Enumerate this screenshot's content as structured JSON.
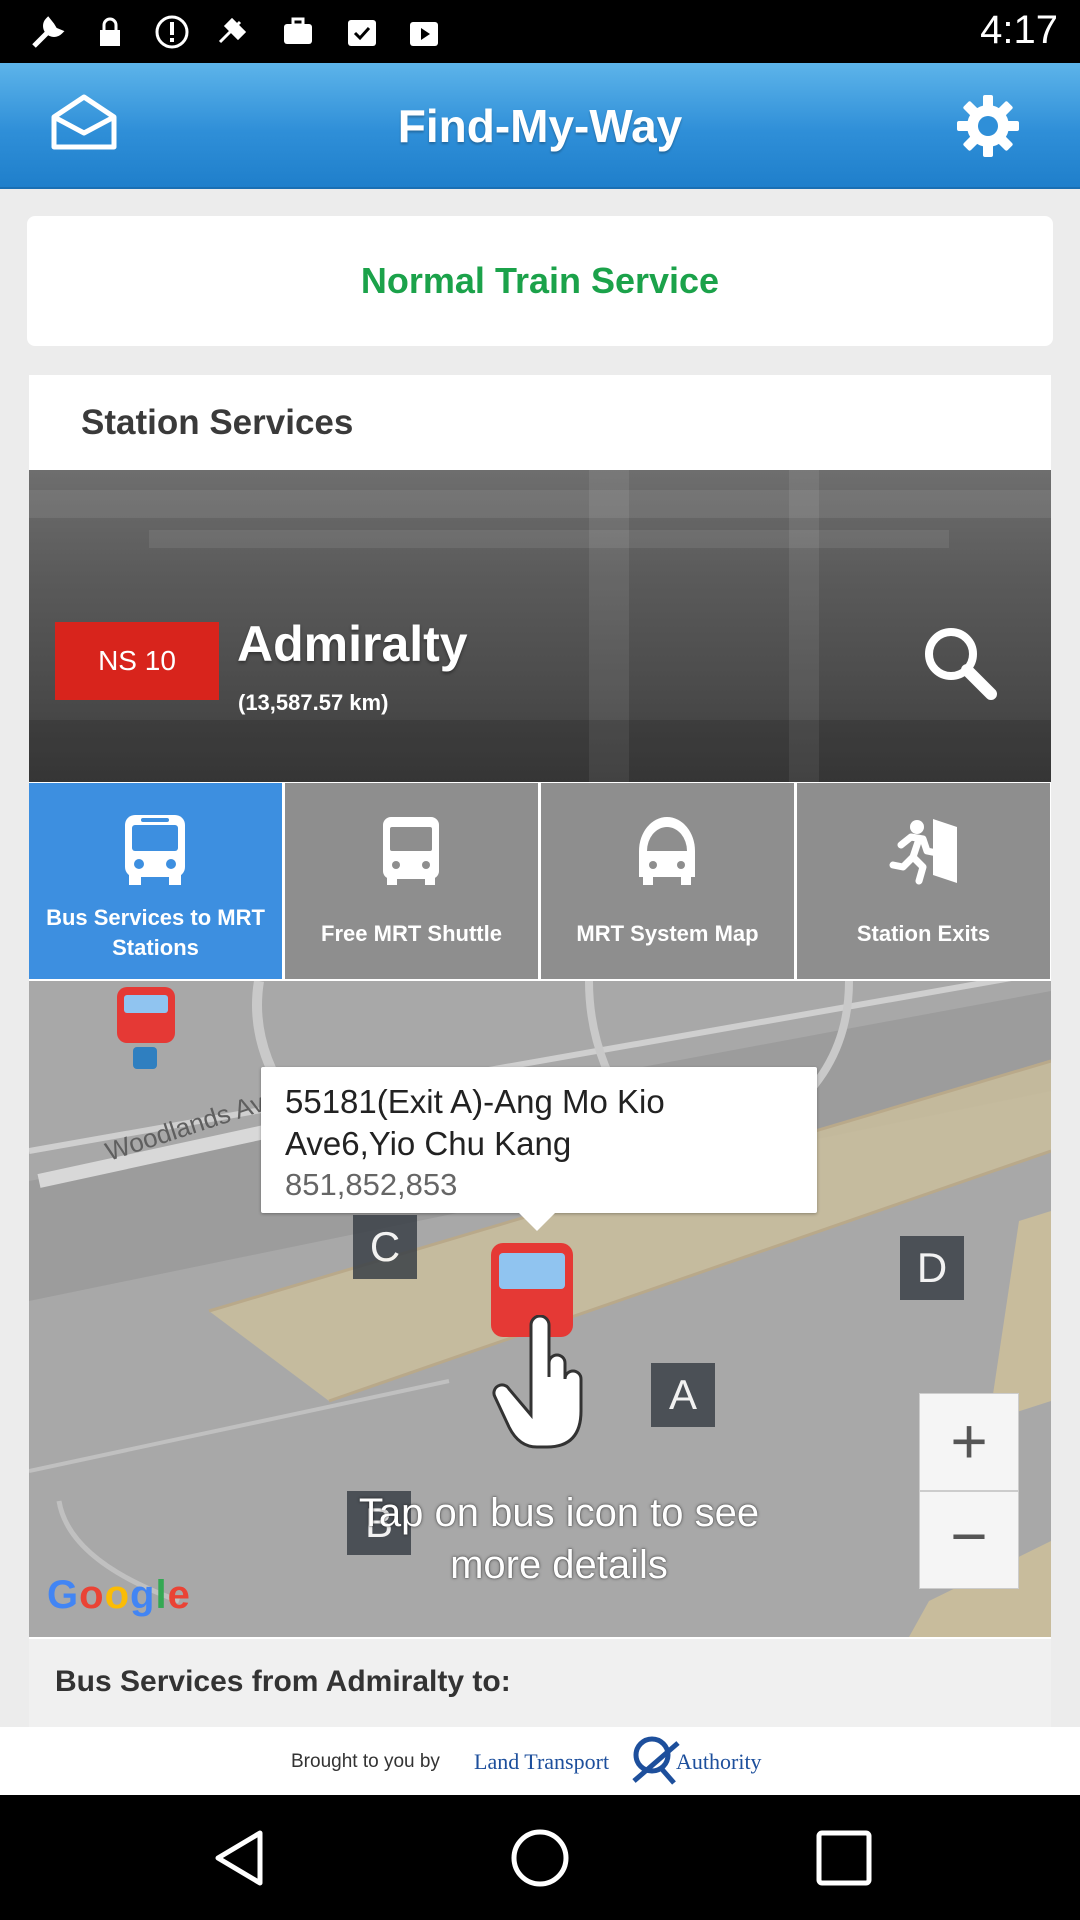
{
  "status_bar": {
    "time": "4:17",
    "icons": [
      "wrench-icon",
      "lock-icon",
      "alert-icon",
      "fake-gps-icon",
      "briefcase-icon",
      "checklist-icon",
      "play-store-icon"
    ]
  },
  "app_bar": {
    "title": "Find-My-Way",
    "left_icon": "envelope-open-icon",
    "right_icon": "gear-icon"
  },
  "service_status": {
    "text": "Normal Train Service",
    "color": "#1ba24a"
  },
  "station_services": {
    "heading": "Station Services",
    "station": {
      "code": "NS 10",
      "name": "Admiralty",
      "distance": "(13,587.57 km)"
    },
    "tiles": [
      {
        "label": "Bus Services to MRT Stations",
        "icon": "bus-icon",
        "active": true
      },
      {
        "label": "Free MRT Shuttle",
        "icon": "shuttle-bus-icon",
        "active": false
      },
      {
        "label": "MRT System Map",
        "icon": "train-icon",
        "active": false
      },
      {
        "label": "Station Exits",
        "icon": "exit-running-icon",
        "active": false
      }
    ]
  },
  "map": {
    "road_label": "Woodlands Av",
    "bus_stop": {
      "name": "55181(Exit A)-Ang Mo Kio Ave6,Yio Chu Kang",
      "services": "851,852,853"
    },
    "exits": [
      "C",
      "D",
      "A",
      "B"
    ],
    "hint": "Tap on bus icon to see more details",
    "zoom_in": "+",
    "zoom_out": "−",
    "attribution": "Google"
  },
  "bus_services_from": "Bus Services from Admiralty to:",
  "footer": {
    "brought_by": "Brought to you by",
    "org_part1": "Land Transport",
    "org_part2": "Authority"
  },
  "accent_color": "#3d8fe0",
  "station_code_color": "#d8241c"
}
